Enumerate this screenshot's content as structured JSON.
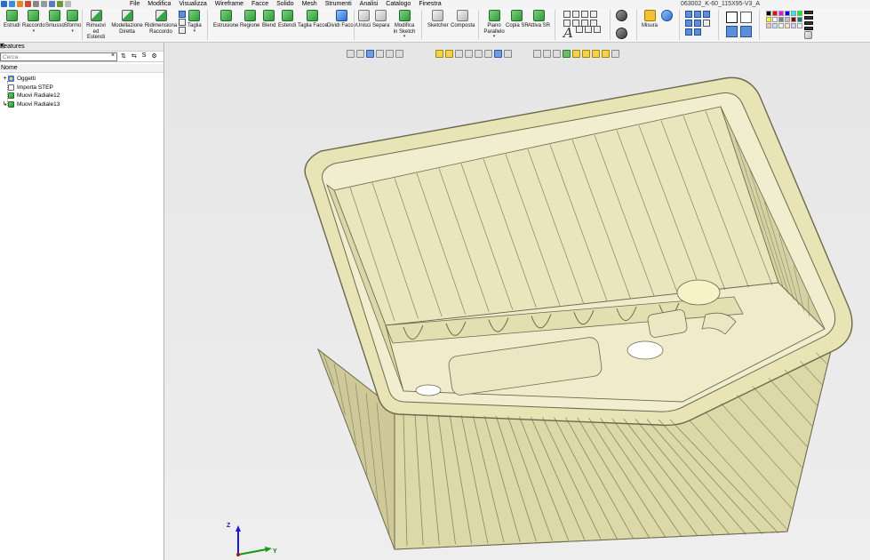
{
  "window": {
    "title": "063002_K-60_115X95-V3_A"
  },
  "menu": [
    "File",
    "Modifica",
    "Visualizza",
    "Wireframe",
    "Facce",
    "Solido",
    "Mesh",
    "Strumenti",
    "Analisi",
    "Catalogo",
    "Finestra"
  ],
  "ribbon": {
    "estrudi": "Estrudi",
    "raccordo": "Raccordo",
    "smusso": "Smusso",
    "sformo": "Sformo",
    "rimuovi": "Rimuovi ed Estendi",
    "modellazione": "Modellazione Diretta",
    "ridimensiona": "Ridimensiona Raccordo",
    "taglia": "Taglia",
    "estrusione": "Estrusione",
    "regione": "Regione",
    "blend": "Blend",
    "estendi": "Estendi",
    "taglia_facce": "Taglia Facce",
    "dividi_facce": "Dividi Facce",
    "unisci": "Unisci",
    "separa": "Separa",
    "modifica_sketch": "Modifica in Sketch",
    "sketcher": "Sketcher",
    "composta": "Composta",
    "piano_parallelo": "Piano Parallelo",
    "copia_sr": "Copia SR",
    "attiva_sr": "Attiva SR",
    "misura": "Misura"
  },
  "panel": {
    "title": "Features",
    "search_placeholder": "Cerca",
    "column_header": "Nome",
    "tree": [
      {
        "label": "Oggetti",
        "expander": "+"
      },
      {
        "label": "Importa STEP",
        "expander": ""
      },
      {
        "label": "Muovi Radiale12",
        "expander": ""
      },
      {
        "label": "Muovi Radiale13",
        "expander": ""
      }
    ]
  },
  "triad": {
    "z": "Z",
    "y": "Y"
  },
  "colors": {
    "model_fill": "#e8e4b6",
    "model_edge": "#6b6a4c",
    "viewport_bg": "#e8e8e8",
    "palette": [
      "#000000",
      "#ff0000",
      "#ff00ff",
      "#0000ff",
      "#00ffff",
      "#00ff00",
      "#ffff00",
      "#ffffff",
      "#808080",
      "#c0c0c0",
      "#800000",
      "#008080",
      "#ffc0c0",
      "#c0e0ff",
      "#e0ffe0",
      "#ffe0c0",
      "#d0d0ff",
      "#f0f0f0"
    ]
  }
}
